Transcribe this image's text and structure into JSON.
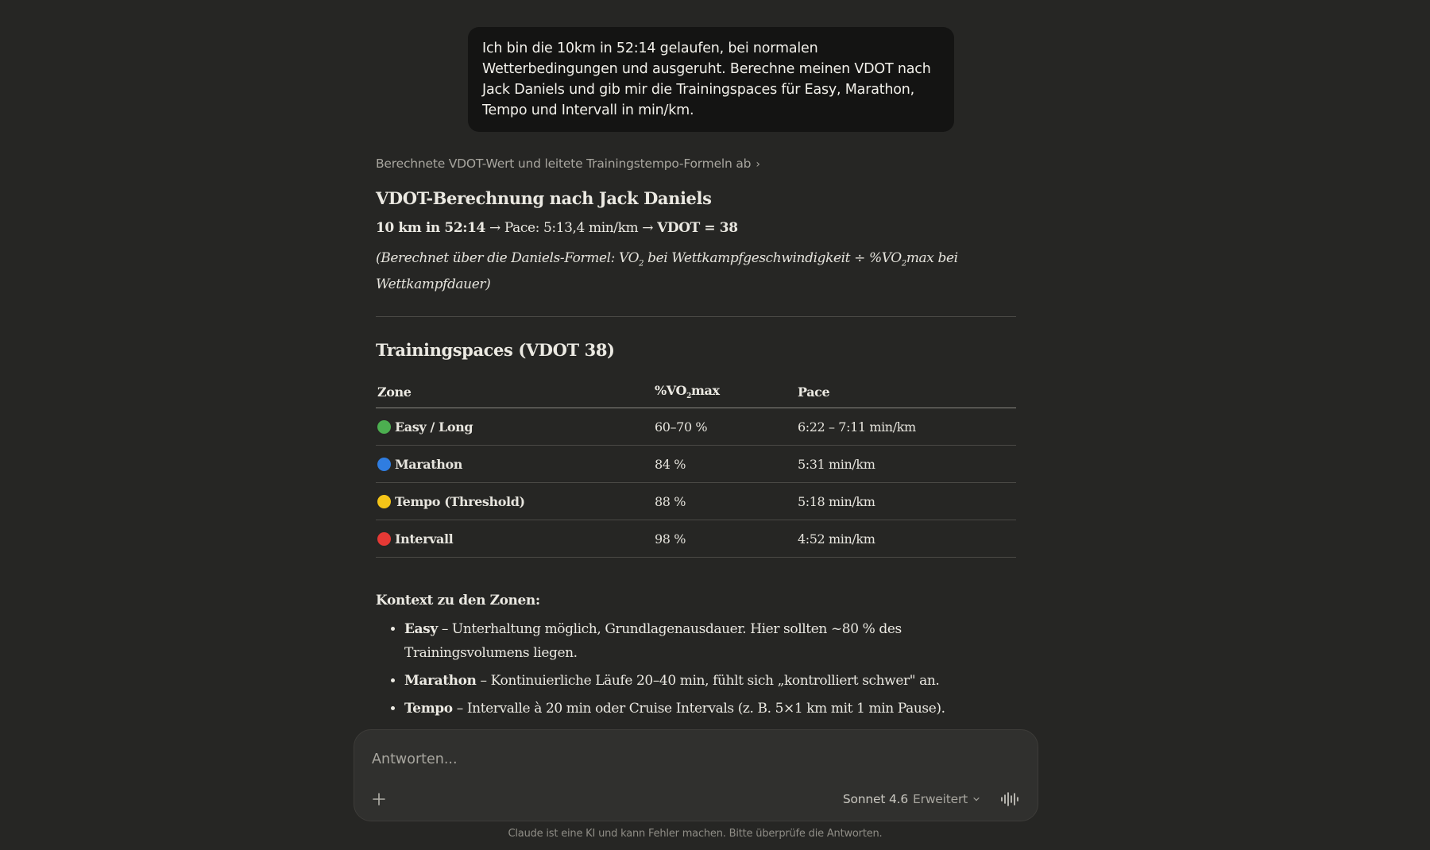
{
  "user_message": "Ich bin die 10km in 52:14 gelaufen, bei normalen Wetterbedingungen und ausgeruht. Berechne meinen VDOT nach Jack Daniels und gib mir die Trainingspaces für Easy, Marathon, Tempo und Intervall in min/km.",
  "thinking": {
    "label": "Berechnete VDOT-Wert und leitete Trainingstempo-Formeln ab",
    "chevron": "›"
  },
  "response": {
    "heading1": "VDOT-Berechnung nach Jack Daniels",
    "result": {
      "race": "10 km in 52:14",
      "arrow1": " → ",
      "pace": "Pace: 5:13,4 min/km",
      "arrow2": " → ",
      "vdot": "VDOT = 38"
    },
    "formula": {
      "part1": "(Berechnet über die Daniels-Formel: VO",
      "sub1": "2",
      "part2": " bei Wettkampfgeschwindigkeit ÷ %VO",
      "sub2": "2",
      "part3": "max bei Wettkampfdauer)"
    },
    "heading2": "Trainingspaces (VDOT 38)",
    "table": {
      "headers": {
        "zone": "Zone",
        "vo2_prefix": "%VO",
        "vo2_sub": "2",
        "vo2_suffix": "max",
        "pace": "Pace"
      },
      "rows": [
        {
          "dot_color": "#4caf50",
          "zone": "Easy / Long",
          "vo2": "60–70 %",
          "pace": "6:22 – 7:11 min/km"
        },
        {
          "dot_color": "#2f7de1",
          "zone": "Marathon",
          "vo2": "84 %",
          "pace": "5:31 min/km"
        },
        {
          "dot_color": "#f5c518",
          "zone": "Tempo (Threshold)",
          "vo2": "88 %",
          "pace": "5:18 min/km"
        },
        {
          "dot_color": "#e53935",
          "zone": "Intervall",
          "vo2": "98 %",
          "pace": "4:52 min/km"
        }
      ]
    },
    "context_heading": "Kontext zu den Zonen:",
    "context_items": [
      {
        "term": "Easy",
        "text": " – Unterhaltung möglich, Grundlagenausdauer. Hier sollten ~80 % des Trainingsvolumens liegen."
      },
      {
        "term": "Marathon",
        "text": " – Kontinuierliche Läufe 20–40 min, fühlt sich „kontrolliert schwer\" an."
      },
      {
        "term": "Tempo",
        "text": " – Intervalle à 20 min oder Cruise Intervals (z. B. 5×1 km mit 1 min Pause)."
      }
    ]
  },
  "composer": {
    "placeholder": "Antworten...",
    "model": "Sonnet 4.6",
    "mode": "Erweitert",
    "icons": {
      "add": "plus-icon",
      "chevron": "chevron-down-icon",
      "voice": "voice-waveform-icon"
    }
  },
  "disclaimer": "Claude ist eine KI und kann Fehler machen. Bitte überprüfe die Antworten.",
  "colors": {
    "background": "#262624",
    "user_bubble": "#141413",
    "composer": "#30302e",
    "text": "#ebe9e2",
    "muted": "#a8a69f"
  }
}
